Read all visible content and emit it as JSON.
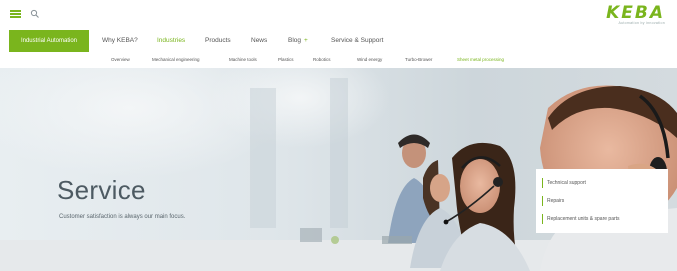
{
  "header": {
    "menu_icon": "hamburger-menu-icon",
    "search_icon": "search-icon",
    "logo": {
      "name": "KEBA",
      "tagline": "Automation by innovation"
    }
  },
  "main_nav": {
    "active": "Industrial Automation",
    "items": [
      {
        "label": "Why KEBA?"
      },
      {
        "label": "Industries",
        "highlighted": true
      },
      {
        "label": "Products"
      },
      {
        "label": "News"
      },
      {
        "label": "Blog",
        "has_plus": true,
        "plus": "+"
      },
      {
        "label": "Service & Support"
      }
    ]
  },
  "sub_nav": {
    "items": [
      {
        "label": "Overview"
      },
      {
        "label": "Mechanical engineering"
      },
      {
        "label": "Machine tools"
      },
      {
        "label": "Plastics"
      },
      {
        "label": "Robotics"
      },
      {
        "label": "Wind energy"
      },
      {
        "label": "Turbo-Brower"
      },
      {
        "label": "Sheet metal processing",
        "highlighted": true
      }
    ]
  },
  "hero": {
    "title": "Service",
    "subtitle": "Customer satisfaction is always our main focus.",
    "links": [
      {
        "label": "Technical support"
      },
      {
        "label": "Repairs"
      },
      {
        "label": "Replacement units & spare parts"
      }
    ]
  },
  "colors": {
    "accent": "#7ab51d",
    "text": "#555555",
    "hero_text": "#4d5a62"
  }
}
